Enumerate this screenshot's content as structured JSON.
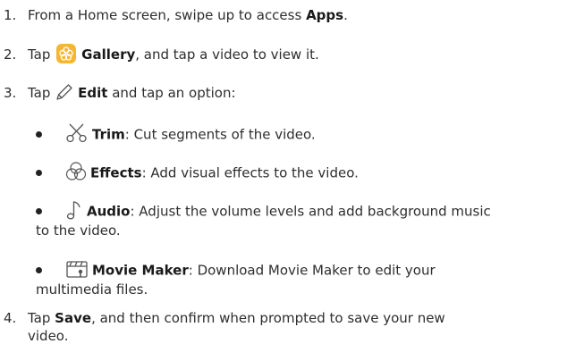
{
  "steps": {
    "s1": {
      "number": "1.",
      "pre": "From a Home screen, swipe up to access ",
      "bold": "Apps",
      "post": "."
    },
    "s2": {
      "number": "2.",
      "pre": "Tap ",
      "icon": "gallery-icon",
      "bold": "Gallery",
      "post": ", and tap a video to view it."
    },
    "s3": {
      "number": "3.",
      "pre": "Tap ",
      "icon": "pencil-icon",
      "bold": "Edit",
      "post": " and tap an option:"
    },
    "s4": {
      "number": "4.",
      "pre": "Tap ",
      "bold": "Save",
      "post": ", and then confirm when prompted to save your new",
      "line2": "video."
    }
  },
  "options": {
    "trim": {
      "icon": "scissors-icon",
      "bold": "Trim",
      "text": ": Cut segments of the video."
    },
    "effects": {
      "icon": "effects-icon",
      "bold": "Effects",
      "text": ": Add visual effects to the video."
    },
    "audio": {
      "icon": "music-note-icon",
      "bold": "Audio",
      "text": ": Adjust the volume levels and add background music",
      "line2": "to the video."
    },
    "movie_maker": {
      "icon": "clapperboard-icon",
      "bold": "Movie Maker",
      "text": ": Download Movie Maker to edit your",
      "line2": "multimedia files."
    }
  },
  "colors": {
    "text": "#2e2e2e",
    "gallery_icon": "#f5b731",
    "icon_stroke": "#555555"
  }
}
